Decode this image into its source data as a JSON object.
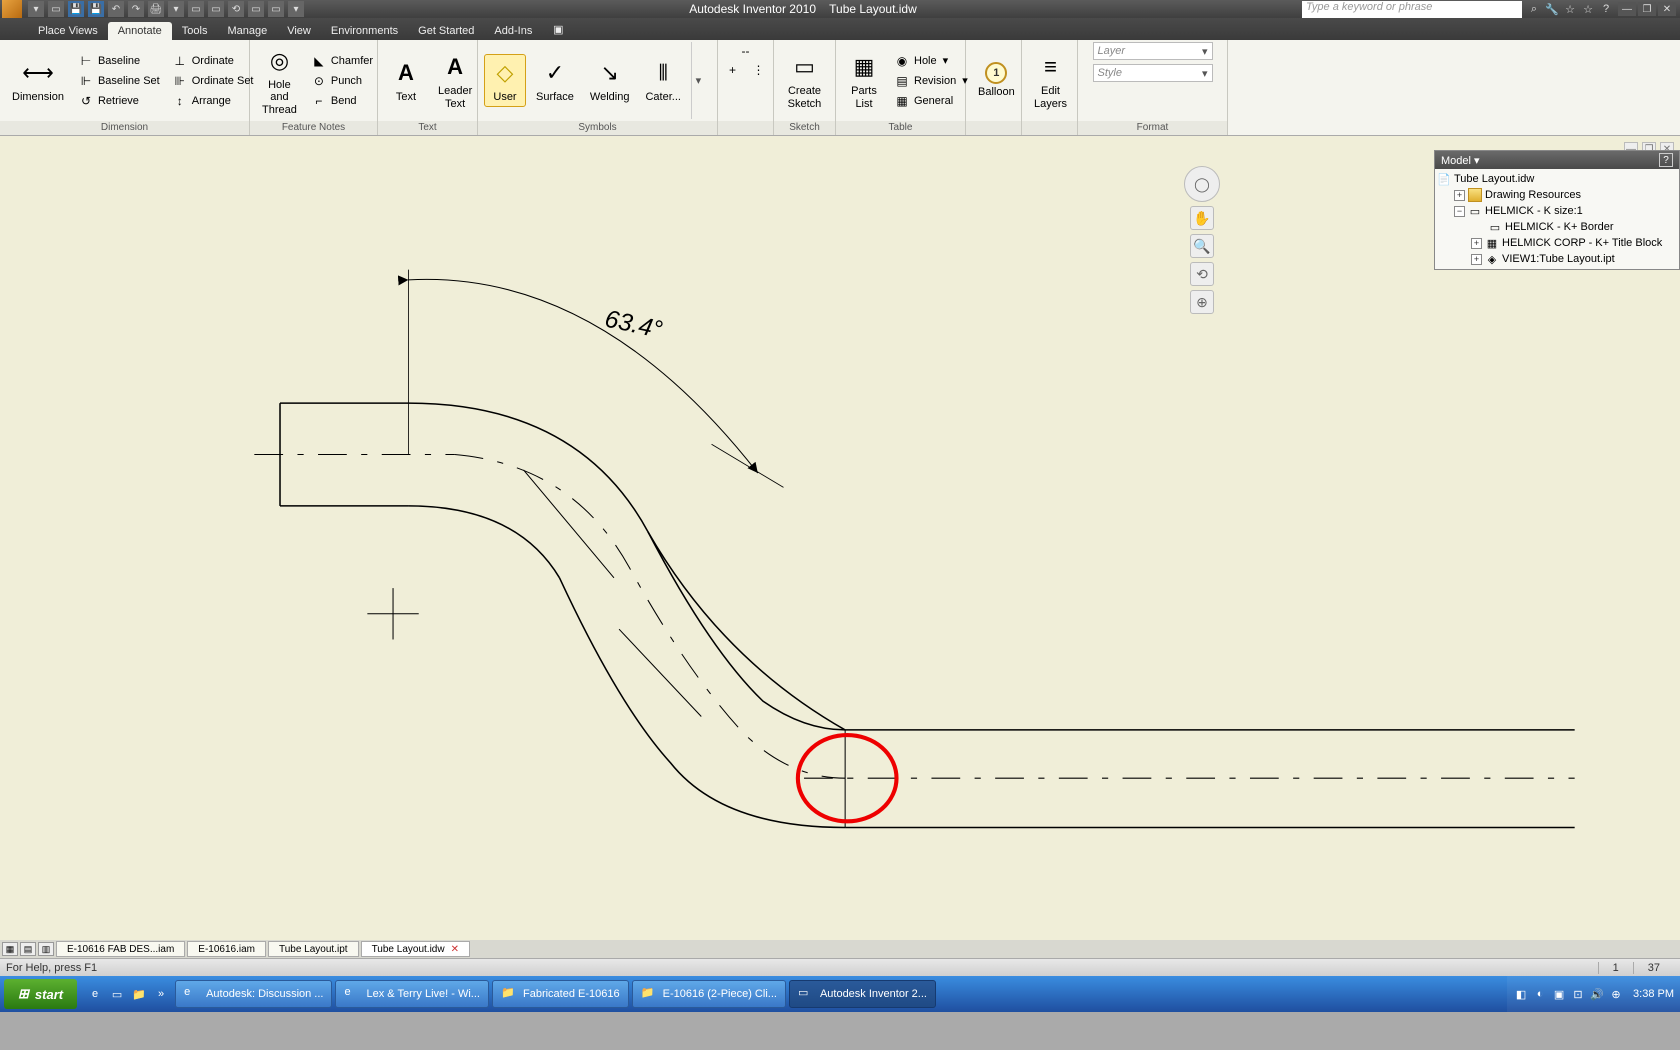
{
  "title": {
    "app": "Autodesk Inventor 2010",
    "file": "Tube Layout.idw"
  },
  "search_placeholder": "Type a keyword or phrase",
  "tabs": [
    "Place Views",
    "Annotate",
    "Tools",
    "Manage",
    "View",
    "Environments",
    "Get Started",
    "Add-Ins"
  ],
  "active_tab": "Annotate",
  "ribbon": {
    "dimension": {
      "big": "Dimension",
      "items": [
        "Baseline",
        "Baseline Set",
        "Retrieve",
        "Ordinate",
        "Ordinate Set",
        "Arrange"
      ],
      "label": "Dimension"
    },
    "feature": {
      "big": "Hole and Thread",
      "items": [
        "Chamfer",
        "Punch",
        "Bend"
      ],
      "label": "Feature Notes"
    },
    "text": {
      "items": [
        "Text",
        "Leader Text"
      ],
      "label": "Text"
    },
    "symbols": {
      "items": [
        "User",
        "Surface",
        "Welding",
        "Cater..."
      ],
      "label": "Symbols"
    },
    "sketch": {
      "big": "Create Sketch",
      "label": "Sketch"
    },
    "table": {
      "big": "Parts List",
      "items": [
        "Hole",
        "Revision",
        "General"
      ],
      "label": "Table"
    },
    "balloon": {
      "text": "Balloon",
      "num": "1"
    },
    "layers": {
      "text": "Edit Layers"
    },
    "format": {
      "layer": "Layer",
      "style": "Style",
      "label": "Format"
    }
  },
  "model": {
    "title": "Model",
    "root": "Tube Layout.idw",
    "items": [
      {
        "label": "Drawing Resources",
        "indent": 1,
        "exp": null,
        "icon": "folder"
      },
      {
        "label": "HELMICK - K size:1",
        "indent": 1,
        "exp": "-",
        "icon": "sheet"
      },
      {
        "label": "HELMICK - K+ Border",
        "indent": 2,
        "exp": null,
        "icon": "border"
      },
      {
        "label": "HELMICK CORP - K+ Title Block",
        "indent": 2,
        "exp": "+",
        "icon": "block"
      },
      {
        "label": "VIEW1:Tube Layout.ipt",
        "indent": 2,
        "exp": "+",
        "icon": "view"
      }
    ]
  },
  "drawing": {
    "angle": "63.4°"
  },
  "doc_tabs": [
    "E-10616 FAB DES...iam",
    "E-10616.iam",
    "Tube Layout.ipt",
    "Tube Layout.idw"
  ],
  "active_doc": "Tube Layout.idw",
  "status": {
    "help": "For Help, press F1",
    "n1": "1",
    "n2": "37"
  },
  "taskbar": {
    "start": "start",
    "items": [
      "Autodesk: Discussion ...",
      "Lex & Terry Live! - Wi...",
      "Fabricated E-10616",
      "E-10616 (2-Piece) Cli...",
      "Autodesk Inventor 2..."
    ],
    "time": "3:38 PM"
  }
}
